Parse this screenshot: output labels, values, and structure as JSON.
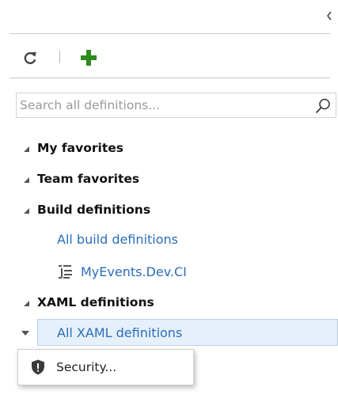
{
  "toolbar": {
    "collapse_icon": "chevron-left-icon",
    "refresh_icon": "refresh-icon",
    "add_icon": "plus-icon",
    "add_color": "#2e8b1f"
  },
  "search": {
    "placeholder": "Search all definitions...",
    "value": "",
    "icon": "search-icon"
  },
  "tree": {
    "groups": [
      {
        "label": "My favorites",
        "expanded": true
      },
      {
        "label": "Team favorites",
        "expanded": true
      },
      {
        "label": "Build definitions",
        "expanded": true,
        "items": [
          {
            "label": "All build definitions"
          },
          {
            "label": "MyEvents.Dev.CI",
            "icon": "build-definition-icon"
          }
        ]
      },
      {
        "label": "XAML definitions",
        "expanded": true,
        "items": [
          {
            "label": "All XAML definitions",
            "selected": true
          }
        ]
      }
    ]
  },
  "context_menu": {
    "items": [
      {
        "label": "Security...",
        "icon": "shield-icon"
      }
    ]
  },
  "colors": {
    "link": "#2a6ebb",
    "selected_bg": "#e6f0fa",
    "selected_border": "#b7d0ea"
  }
}
